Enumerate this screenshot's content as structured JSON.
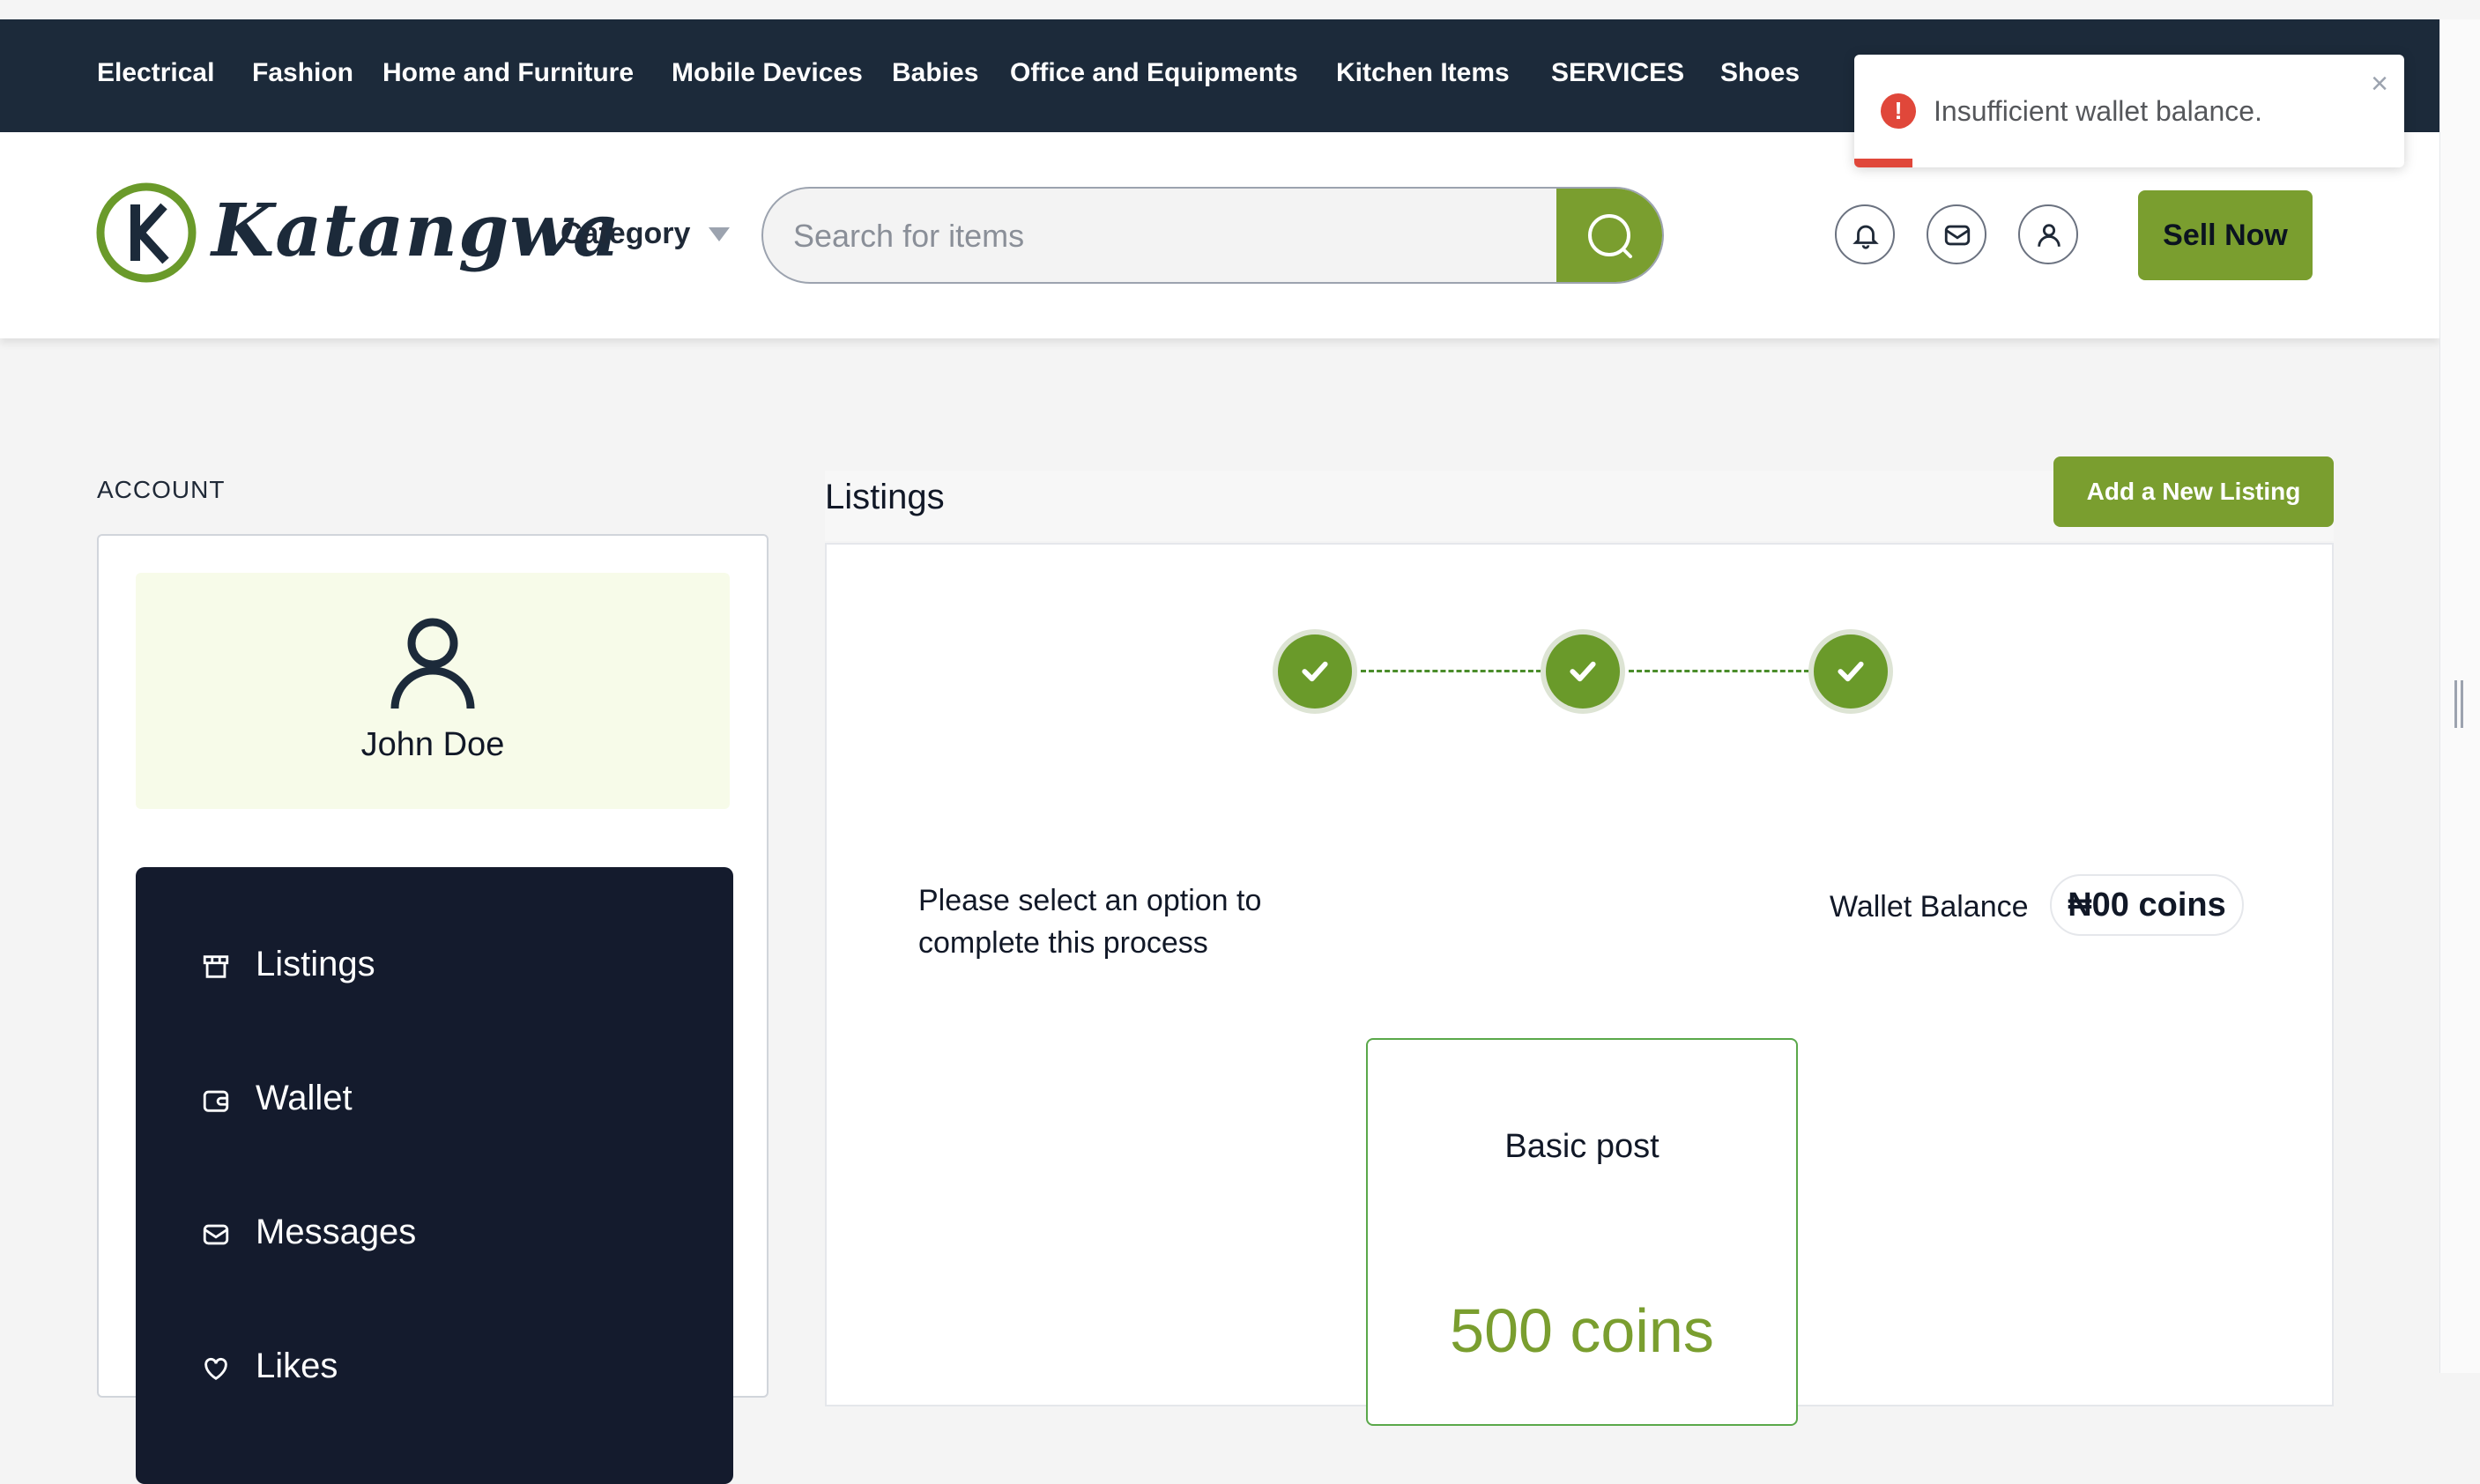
{
  "categories": [
    "Electrical",
    "Fashion",
    "Home and Furniture",
    "Mobile Devices",
    "Babies",
    "Office and Equipments",
    "Kitchen Items",
    "SERVICES",
    "Shoes"
  ],
  "header": {
    "logo_text": "Katangwa",
    "category_label": "Category",
    "search_placeholder": "Search for items",
    "sell_label": "Sell Now"
  },
  "toast": {
    "message": "Insufficient wallet balance.",
    "close": "×",
    "type": "error"
  },
  "account": {
    "label": "ACCOUNT",
    "user_name": "John Doe",
    "menu": [
      {
        "label": "Listings",
        "icon": "store-icon"
      },
      {
        "label": "Wallet",
        "icon": "wallet-icon"
      },
      {
        "label": "Messages",
        "icon": "mail-icon"
      },
      {
        "label": "Likes",
        "icon": "heart-icon"
      }
    ]
  },
  "main": {
    "title": "Listings",
    "add_button": "Add a New Listing",
    "steps_completed": 3,
    "prompt": "Please select an option to complete this process",
    "wallet_label": "Wallet Balance",
    "wallet_value": "₦00 coins",
    "plan": {
      "name": "Basic post",
      "price": "500 coins"
    }
  },
  "colors": {
    "accent": "#7a9e2f",
    "navbar": "#1c2a3a",
    "sidebar_menu": "#141b2d",
    "error": "#e0473a"
  }
}
